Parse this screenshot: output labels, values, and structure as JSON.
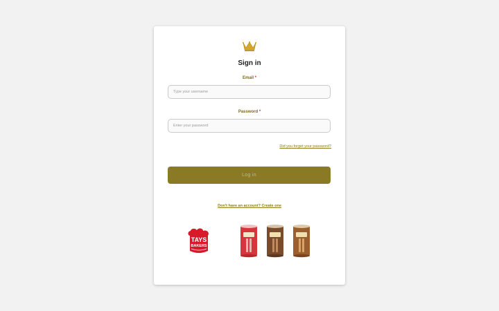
{
  "form": {
    "title": "Sign in",
    "email_label": "Email",
    "email_placeholder": "Type your username",
    "email_value": "",
    "password_label": "Password",
    "password_placeholder": "Enter your password",
    "password_value": "",
    "required_mark": "*",
    "forgot_link": "Did you forget your password?",
    "login_button": "Log in",
    "create_link": "Don't have an account? Create one"
  },
  "branding": {
    "bakers_logo_line1": "TAYS",
    "bakers_logo_line2": "BAKERS"
  },
  "colors": {
    "accent": "#8a7a25",
    "label": "#7d6a16",
    "required": "#c23a3a",
    "background": "#f2f2f2",
    "brand_red": "#d7192a"
  },
  "icons": {
    "app_logo": "crown-icon"
  }
}
